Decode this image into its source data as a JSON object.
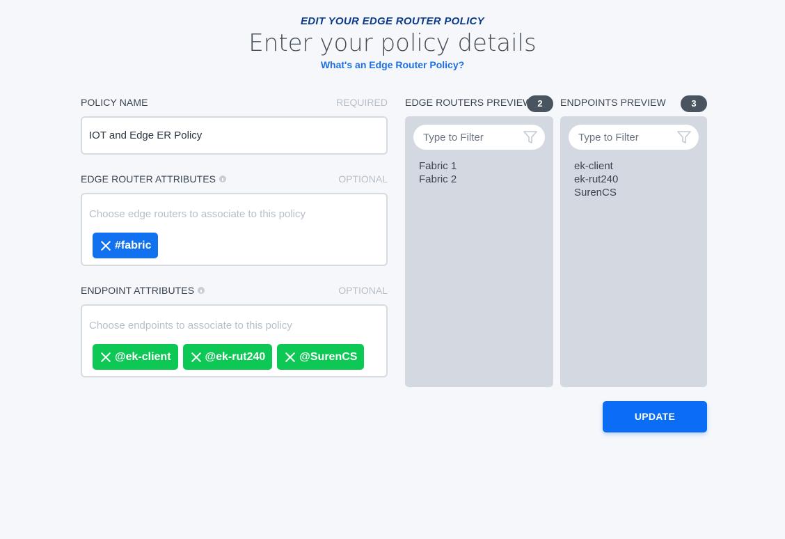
{
  "header": {
    "eyebrow": "EDIT YOUR EDGE ROUTER POLICY",
    "title": "Enter your policy details",
    "help_link": "What's an Edge Router Policy?"
  },
  "form": {
    "policy_name": {
      "label": "POLICY NAME",
      "hint": "REQUIRED",
      "value": "IOT and Edge ER Policy"
    },
    "edge_router_attributes": {
      "label": "EDGE ROUTER ATTRIBUTES",
      "hint": "OPTIONAL",
      "placeholder": "Choose edge routers to associate to this policy",
      "chips": [
        "#fabric"
      ]
    },
    "endpoint_attributes": {
      "label": "ENDPOINT ATTRIBUTES",
      "hint": "OPTIONAL",
      "placeholder": "Choose endpoints to associate to this policy",
      "chips": [
        "@ek-client",
        "@ek-rut240",
        "@SurenCS"
      ]
    }
  },
  "previews": {
    "edge_routers": {
      "label": "EDGE ROUTERS PREVIEW",
      "count": "2",
      "filter_placeholder": "Type to Filter",
      "items": [
        "Fabric 1",
        "Fabric 2"
      ]
    },
    "endpoints": {
      "label": "ENDPOINTS PREVIEW",
      "count": "3",
      "filter_placeholder": "Type to Filter",
      "items": [
        "ek-client",
        "ek-rut240",
        "SurenCS"
      ]
    }
  },
  "actions": {
    "update_label": "UPDATE"
  },
  "colors": {
    "accent": "#0b6cf5",
    "attribute_chip_router": "#1271ee",
    "attribute_chip_endpoint": "#0dc855",
    "preview_bg": "#d4d9e1",
    "badge": "#4a5360"
  },
  "icons": {
    "chip_remove": "close-icon",
    "filter": "funnel-icon",
    "info": "info-icon"
  }
}
